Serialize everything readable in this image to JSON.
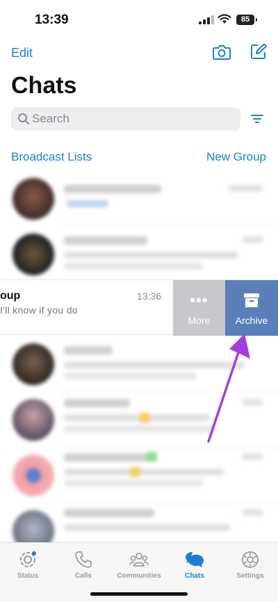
{
  "status_bar": {
    "time": "13:39",
    "battery": "85"
  },
  "header": {
    "edit_label": "Edit",
    "title": "Chats"
  },
  "search": {
    "placeholder": "Search"
  },
  "links": {
    "broadcast": "Broadcast Lists",
    "new_group": "New Group"
  },
  "swiped_chat": {
    "name_fragment": "oup",
    "time": "13:36",
    "preview_fragment": "I'll know if you do"
  },
  "swipe_actions": {
    "more_label": "More",
    "archive_label": "Archive"
  },
  "colors": {
    "accent": "#1b7ed6",
    "archive": "#5a7fb8",
    "more": "#c7c7cc",
    "arrow": "#a23fe0"
  },
  "tabs": [
    {
      "label": "Status",
      "icon": "status-icon"
    },
    {
      "label": "Calls",
      "icon": "phone-icon"
    },
    {
      "label": "Communities",
      "icon": "communities-icon"
    },
    {
      "label": "Chats",
      "icon": "chats-icon",
      "active": true
    },
    {
      "label": "Settings",
      "icon": "gear-icon"
    }
  ]
}
